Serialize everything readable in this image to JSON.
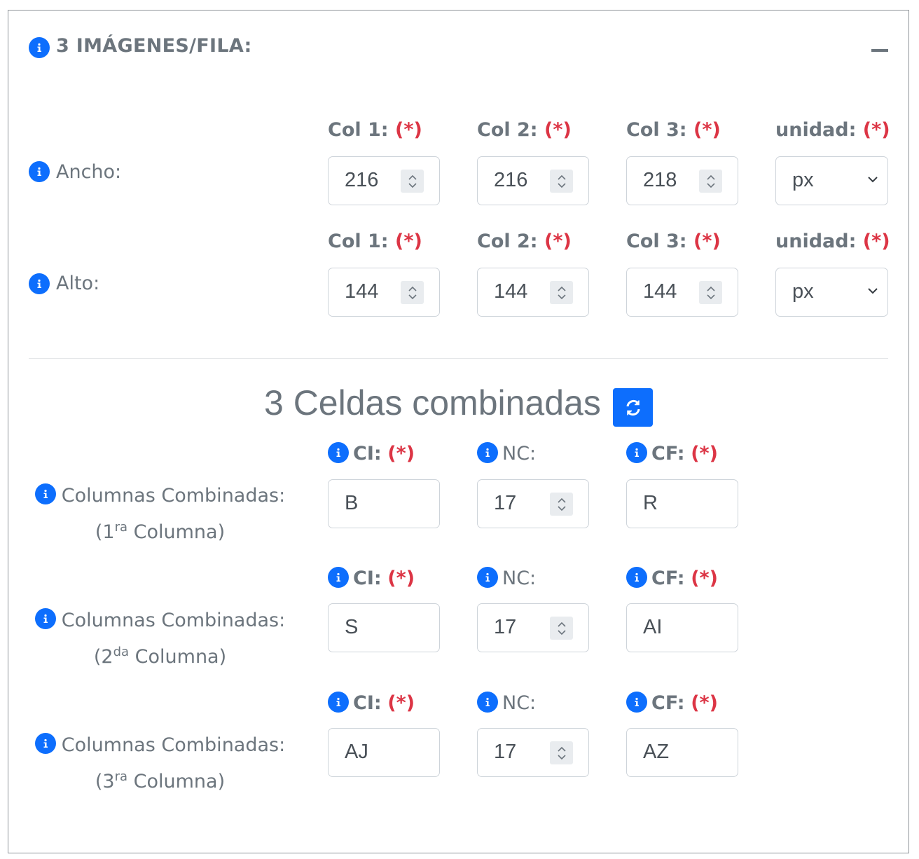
{
  "card": {
    "title": "3 IMÁGENES/FILA:"
  },
  "dimensions": {
    "headers": {
      "col1": "Col 1:",
      "col2": "Col 2:",
      "col3": "Col 3:",
      "unit": "unidad:",
      "required": "(*)"
    },
    "rows": [
      {
        "label": "Ancho:",
        "col1": "216",
        "col2": "216",
        "col3": "218",
        "unit": "px"
      },
      {
        "label": "Alto:",
        "col1": "144",
        "col2": "144",
        "col3": "144",
        "unit": "px"
      }
    ]
  },
  "merged": {
    "title": "3 Celdas combinadas",
    "headers": {
      "ci": "CI:",
      "nc": "NC:",
      "cf": "CF:",
      "required": "(*)"
    },
    "rows": [
      {
        "label": "Columnas Combinadas:",
        "ordinal_num": "1",
        "ordinal_sup": "ra",
        "suffix": "Columna)",
        "prefix": "(",
        "ci": "B",
        "nc": "17",
        "cf": "R"
      },
      {
        "label": "Columnas Combinadas:",
        "ordinal_num": "2",
        "ordinal_sup": "da",
        "suffix": "Columna)",
        "prefix": "(",
        "ci": "S",
        "nc": "17",
        "cf": "AI"
      },
      {
        "label": "Columnas Combinadas:",
        "ordinal_num": "3",
        "ordinal_sup": "ra",
        "suffix": "Columna)",
        "prefix": "(",
        "ci": "AJ",
        "nc": "17",
        "cf": "AZ"
      }
    ]
  },
  "colors": {
    "primary": "#0d6efd",
    "required": "#dc3545",
    "text": "#6c757d"
  }
}
